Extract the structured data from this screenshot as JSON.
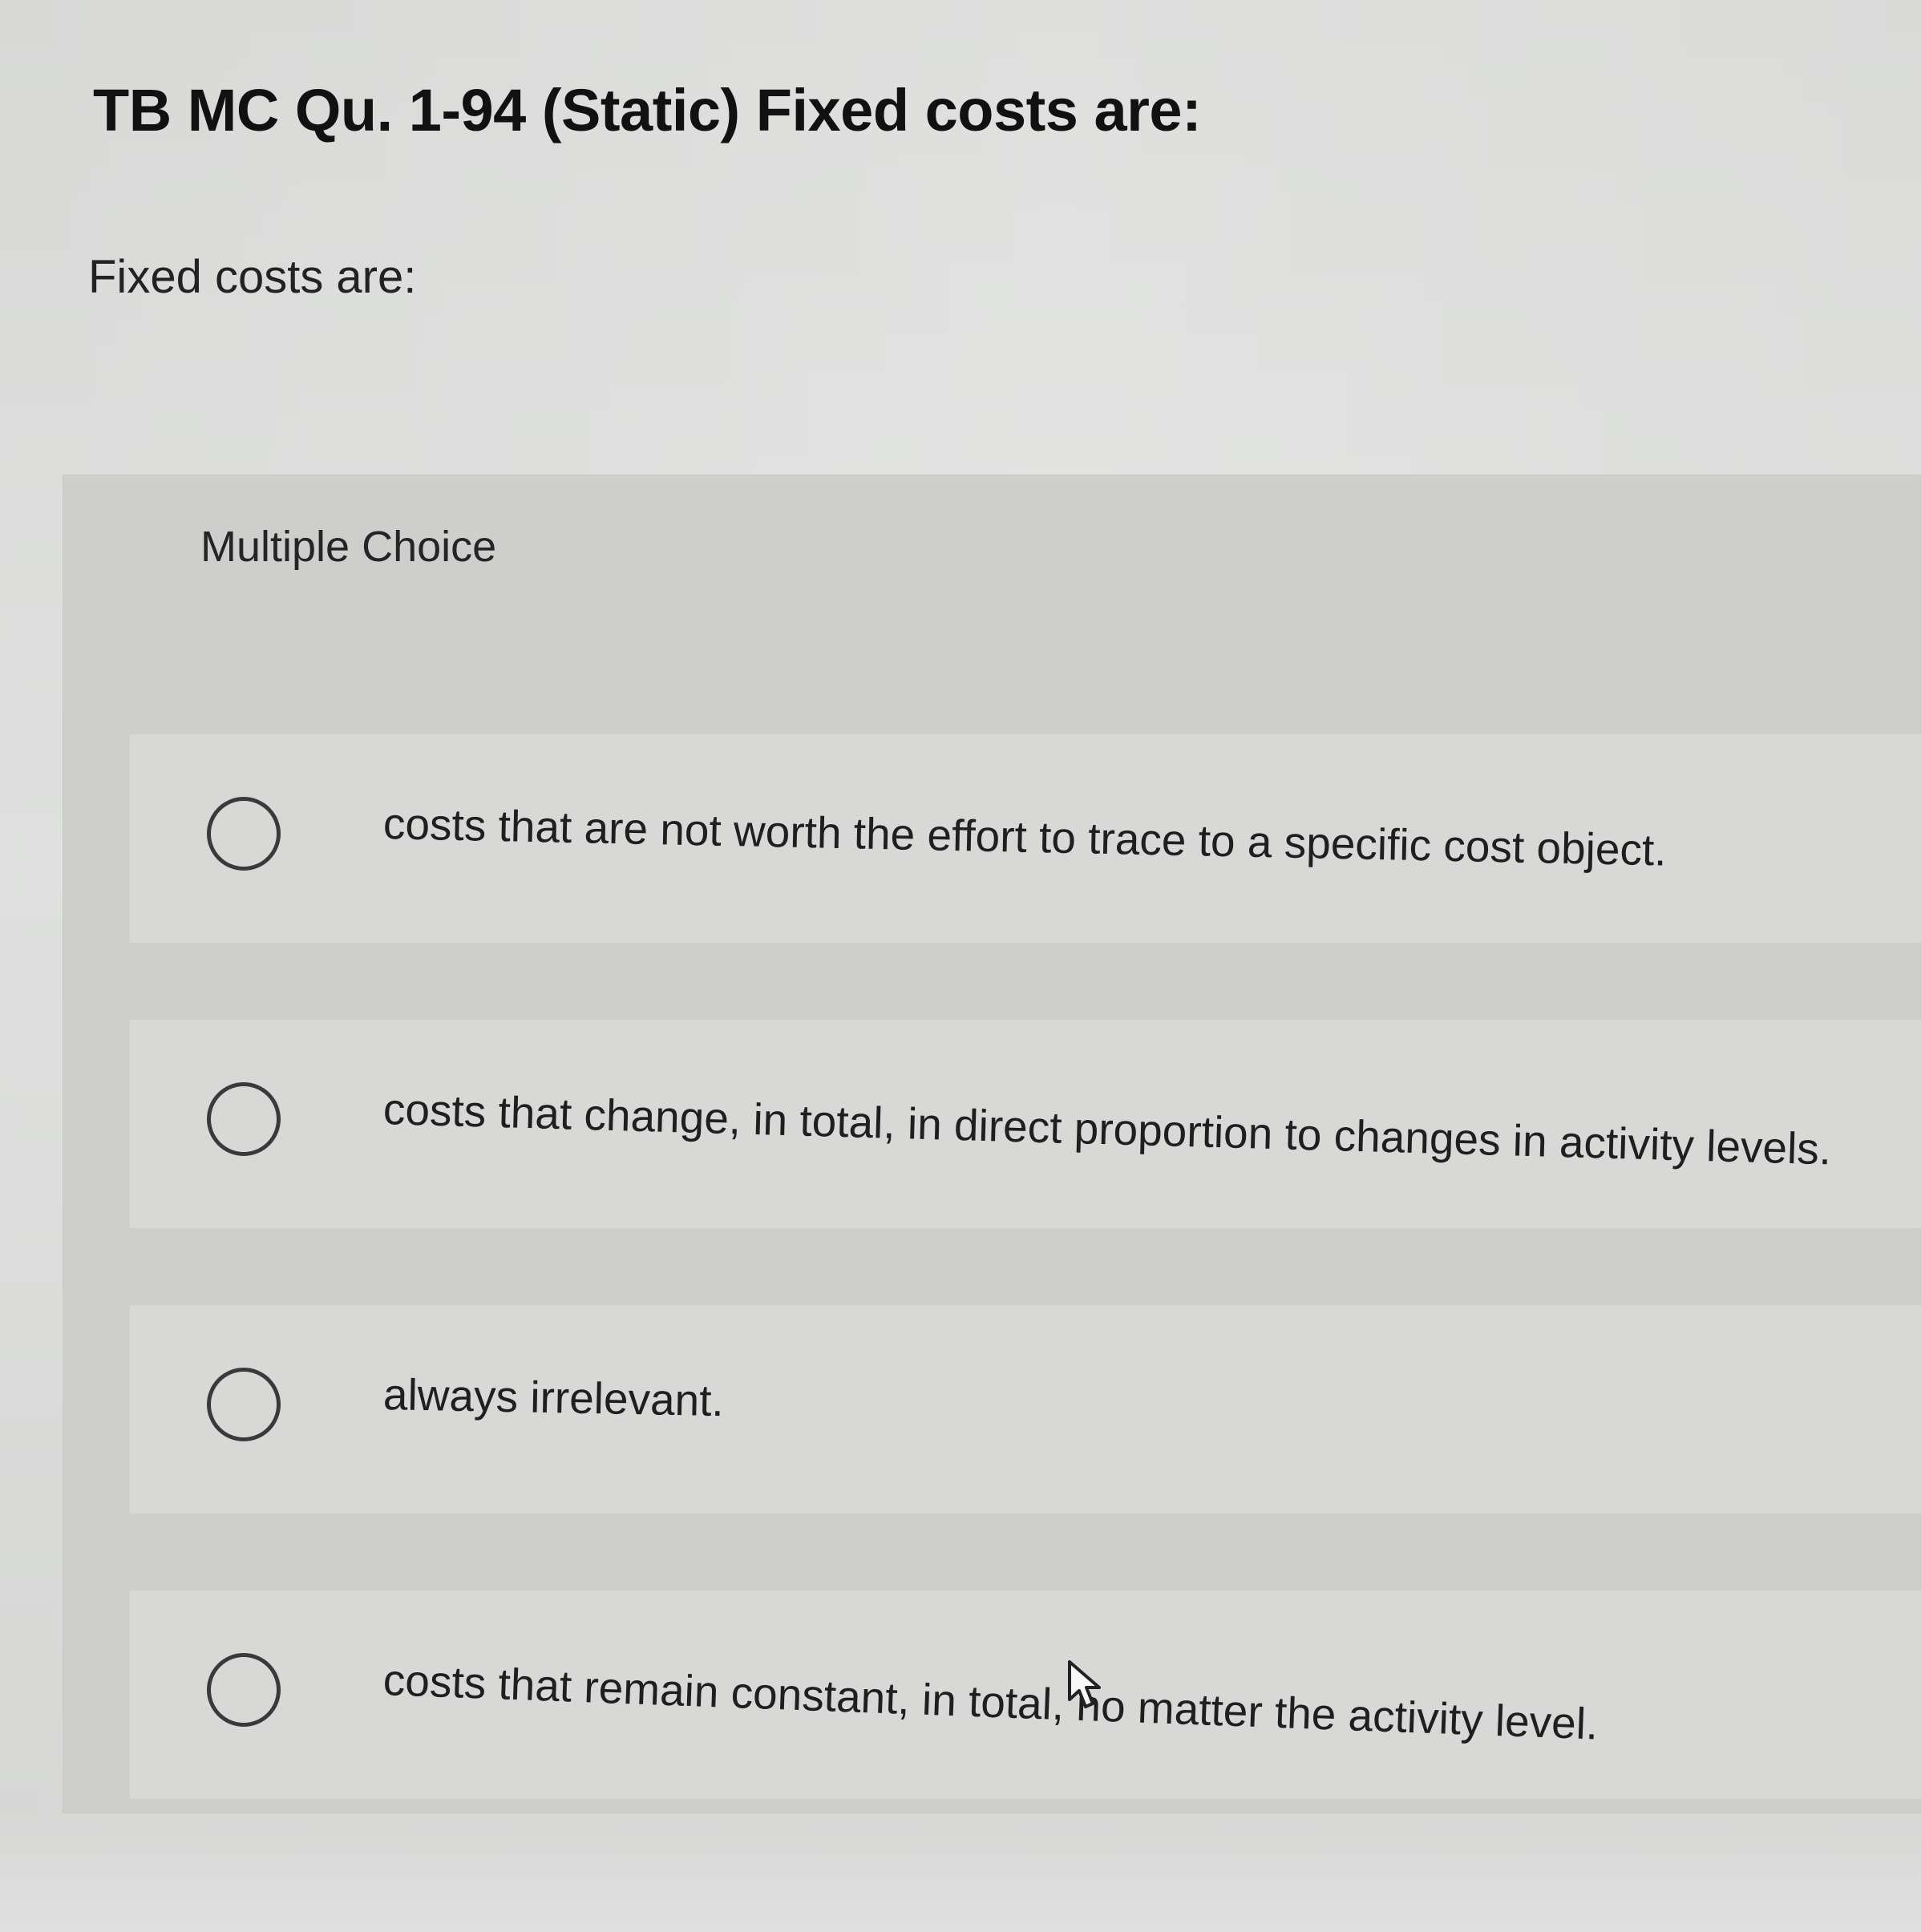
{
  "question": {
    "title": "TB MC Qu. 1-94 (Static) Fixed costs are:",
    "prompt": "Fixed costs are:"
  },
  "answer_area": {
    "type_label": "Multiple Choice",
    "options": [
      {
        "label": "costs that are not worth the effort to trace to a specific cost object."
      },
      {
        "label": "costs that change, in total, in direct proportion to changes in activity levels."
      },
      {
        "label": "always irrelevant."
      },
      {
        "label": "costs that remain constant, in total, no matter the activity level."
      }
    ]
  },
  "icons": {
    "radio": "radio-unselected-icon",
    "cursor": "mouse-pointer-icon"
  }
}
